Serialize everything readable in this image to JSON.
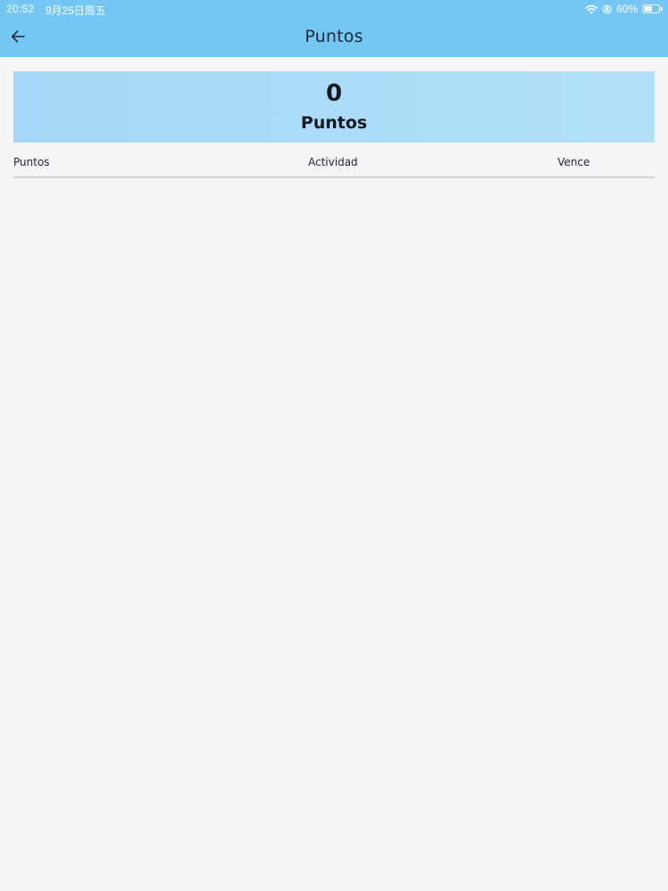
{
  "status_bar": {
    "time": "20:52",
    "date": "9月25日周五",
    "battery_percent_label": "60%",
    "battery_level": 0.6
  },
  "nav": {
    "title": "Puntos",
    "back_icon": "arrow-left-icon"
  },
  "points_card": {
    "value": "0",
    "label": "Puntos"
  },
  "table": {
    "columns": [
      "Puntos",
      "Actividad",
      "Vence"
    ],
    "rows": []
  },
  "colors": {
    "header_blue": "#74c7f4",
    "card_blue": "#a5d7f6",
    "background": "#f5f4f7"
  }
}
